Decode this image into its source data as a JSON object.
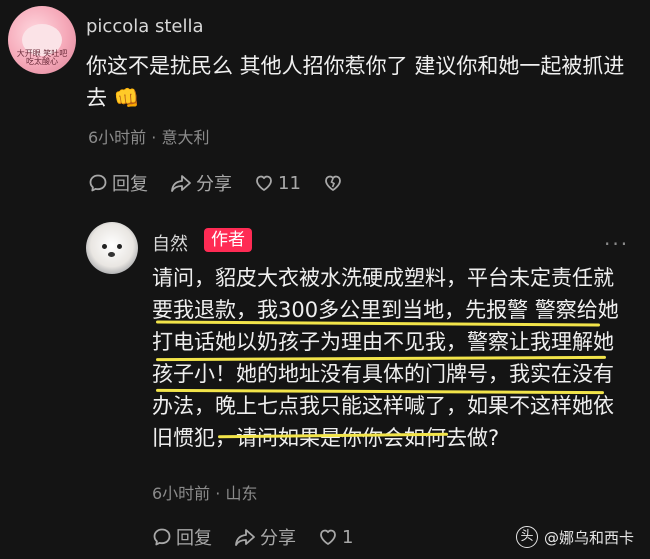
{
  "comment1": {
    "username": "piccola stella",
    "avatar_text": "大开眼 笑吐吧 吃太酸心",
    "text_line1": "你这不是扰民么  其他人招你惹你了  建议你和她一起被抓进",
    "text_line2": "去",
    "emoji": "👊",
    "meta": "6小时前 · 意大利",
    "reply_label": "回复",
    "share_label": "分享",
    "like_count": "11"
  },
  "comment2": {
    "username": "自然",
    "author_tag": "作者",
    "lines": [
      "请问，貂皮大衣被水洗硬成塑料，平台未定责任就",
      "要我退款，我300多公里到当地，先报警  警察给她",
      "打电话她以奶孩子为理由不见我，警察让我理解她",
      "孩子小！她的地址没有具体的门牌号，我实在没有",
      "办法，晚上七点我只能这样喊了，如果不这样她依",
      "旧惯犯，请问如果是你你会如何去做?"
    ],
    "meta": "6小时前 · 山东",
    "reply_label": "回复",
    "share_label": "分享",
    "like_count": "1"
  },
  "watermark": "@娜乌和西卡",
  "colors": {
    "accent": "#ff2b54",
    "highlight": "#f2e44a",
    "background": "#141414"
  }
}
